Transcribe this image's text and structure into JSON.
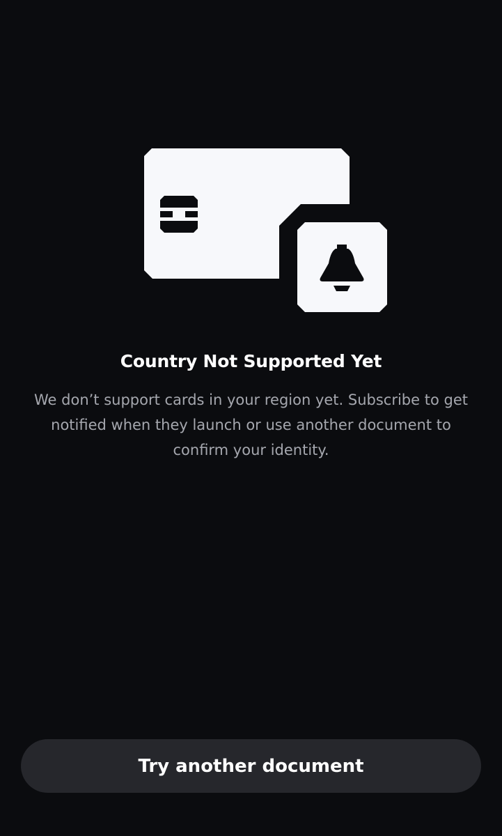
{
  "screen": {
    "title": "Country Not Supported Yet",
    "message": "We don’t support cards in your region yet. Subscribe to get notified when they launch or use another document to confirm your identity."
  },
  "actions": {
    "primary_label": "Try another document"
  },
  "illustration": {
    "icons": [
      "id-card-icon",
      "card-chip-icon",
      "bell-icon"
    ]
  },
  "colors": {
    "background": "#0b0c0f",
    "illustration": "#f7f8fb",
    "title": "#ffffff",
    "body_text": "#a5a7ae",
    "button_background": "#26272c",
    "button_text": "#ffffff"
  }
}
